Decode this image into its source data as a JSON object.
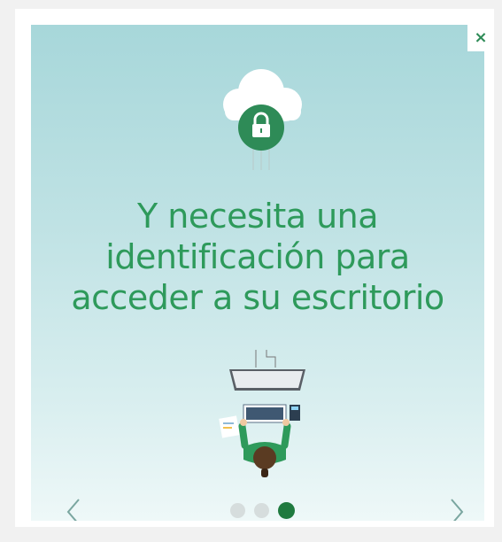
{
  "dialog": {
    "close_label": "×",
    "headline_lines": [
      "Y necesita una",
      "identificación para",
      "acceder a su escritorio"
    ],
    "icons": {
      "close": "close-icon",
      "cloud": "cloud-icon",
      "lock": "lock-icon",
      "desk": "desk-illustration",
      "prev": "chevron-left-icon",
      "next": "chevron-right-icon"
    },
    "colors": {
      "accent": "#2e9a5b",
      "dark_accent": "#1f7a3f",
      "background_top": "#a7d7da",
      "background_bottom": "#eef8f8",
      "dot_inactive": "#d6dddd"
    },
    "carousel": {
      "total_slides": 3,
      "active_index": 3
    }
  }
}
